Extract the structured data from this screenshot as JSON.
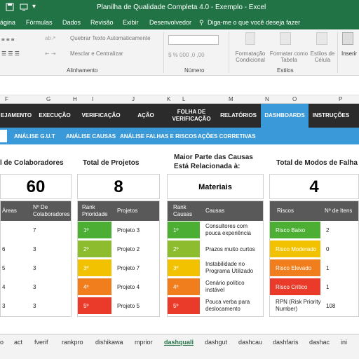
{
  "window": {
    "title": "Planilha de Qualidade Completa 4.0 - Exemplo  -  Excel"
  },
  "menu": [
    "ágina",
    "Fórmulas",
    "Dados",
    "Revisão",
    "Exibir",
    "Desenvolvedor",
    "Diga-me o que você deseja fazer"
  ],
  "ribbon": {
    "wrap_text": "Quebrar Texto Automaticamente",
    "merge_center": "Mesclar e Centralizar",
    "alignment_group": "Alinhamento",
    "number_group": "Número",
    "conditional_formatting": "Formatação Condicional",
    "format_as_table": "Formatar como Tabela",
    "cell_styles": "Estilos de Célula",
    "styles_group": "Estilos",
    "insert": "Inserir"
  },
  "columns": [
    "F",
    "G",
    "H",
    "I",
    "J",
    "K",
    "L",
    "M",
    "N",
    "O",
    "P"
  ],
  "nav_main": [
    "EJAMENTO",
    "EXECUÇÃO",
    "VERIFICAÇÃO",
    "AÇÃO",
    "FOLHA DE VERIFICAÇÃO",
    "RELATÓRIOS",
    "DASHBOARDS",
    "INSTRUÇÕES"
  ],
  "nav_sub": [
    "ANÁLISE G.U.T",
    "ANÁLISE CAUSAS",
    "ANÁLISE FALHAS E RISCOS",
    "AÇÕES CORRETIVAS"
  ],
  "cards": {
    "colaboradores": {
      "title": "l de Colaboradores",
      "value": "60",
      "headers": [
        "Áreas",
        "Nº De Colaboradores"
      ],
      "rows": [
        {
          "area": "",
          "count": "7"
        },
        {
          "area": "6",
          "count": "3"
        },
        {
          "area": "5",
          "count": "3"
        },
        {
          "area": "4",
          "count": "3"
        },
        {
          "area": "3",
          "count": "3"
        }
      ]
    },
    "projetos": {
      "title": "Total de Projetos",
      "value": "8",
      "headers": [
        "Rank Prioridade",
        "Projetos"
      ],
      "rows": [
        {
          "rank": "1º",
          "name": "Projeto 3",
          "color": "#4caf34"
        },
        {
          "rank": "2º",
          "name": "Projeto 2",
          "color": "#8dbd2e"
        },
        {
          "rank": "3º",
          "name": "Projeto 7",
          "color": "#f2c200"
        },
        {
          "rank": "4º",
          "name": "Projeto 4",
          "color": "#f07e1c"
        },
        {
          "rank": "5º",
          "name": "Projeto 5",
          "color": "#ea3a2a"
        }
      ]
    },
    "causas": {
      "title": "Maior Parte das Causas Está Relacionada à:",
      "value": "Materiais",
      "headers": [
        "Rank Causas",
        "Causas"
      ],
      "rows": [
        {
          "rank": "1º",
          "name": "Consultores com pouca experiência",
          "color": "#4caf34"
        },
        {
          "rank": "2º",
          "name": "Prazos muito curtos",
          "color": "#8dbd2e"
        },
        {
          "rank": "3º",
          "name": "Instabilidade no Programa Utilizado",
          "color": "#f2c200"
        },
        {
          "rank": "4º",
          "name": "Cenário político instável",
          "color": "#f07e1c"
        },
        {
          "rank": "5º",
          "name": "Pouca verba para deslocamento",
          "color": "#ea3a2a"
        }
      ]
    },
    "falhas": {
      "title": "Total de Modos de Falha",
      "value": "4",
      "headers": [
        "Riscos",
        "Nº de Itens"
      ],
      "rows": [
        {
          "risk": "Risco Baixo",
          "count": "2",
          "color": "#4caf34"
        },
        {
          "risk": "Risco Moderado",
          "count": "0",
          "color": "#f2c200"
        },
        {
          "risk": "Risco Elevado",
          "count": "1",
          "color": "#f07e1c"
        },
        {
          "risk": "Risco Crítico",
          "count": "1",
          "color": "#ea3a2a"
        },
        {
          "risk": "RPN (Risk Priority Number)",
          "count": "108",
          "color": ""
        }
      ]
    }
  },
  "sheet_tabs": [
    "o",
    "act",
    "fverif",
    "rankpro",
    "dishikawa",
    "mprior",
    "dashquali",
    "dashgut",
    "dashcau",
    "dashfaris",
    "dashac",
    "ini"
  ],
  "active_sheet": "dashquali",
  "colors": {
    "excel_green": "#217346",
    "nav_dark": "#2b2b2b",
    "accent_blue": "#3a9ad9",
    "header_gray": "#595959"
  }
}
